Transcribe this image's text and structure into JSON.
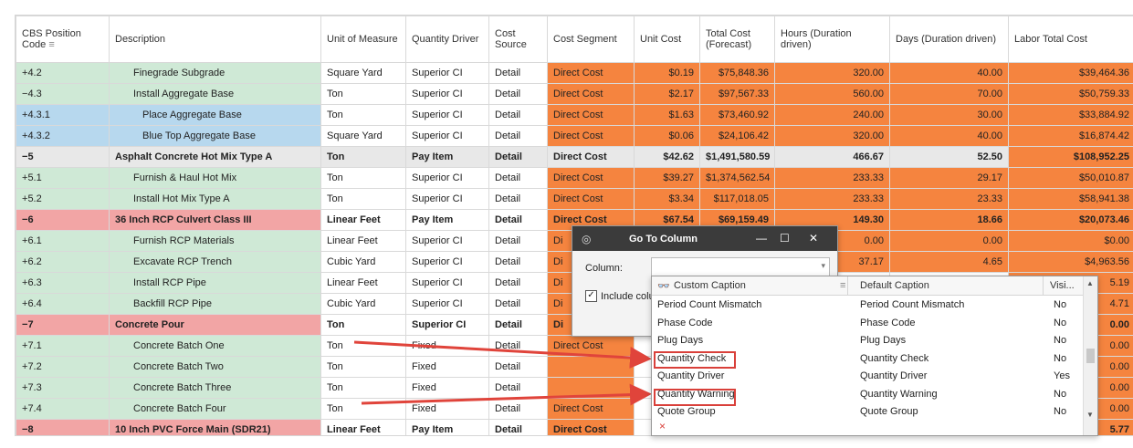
{
  "columns": {
    "code": "CBS Position Code",
    "description": "Description",
    "uom": "Unit of Measure",
    "qty_driver": "Quantity Driver",
    "cost_source": "Cost Source",
    "cost_segment": "Cost Segment",
    "unit_cost": "Unit Cost",
    "total_cost": "Total Cost (Forecast)",
    "hours": "Hours (Duration driven)",
    "days": "Days (Duration driven)",
    "labor_total": "Labor Total Cost"
  },
  "rows": [
    {
      "pm": "+",
      "code": "4.2",
      "description": "Finegrade Subgrade",
      "uom": "Square Yard",
      "qty_driver": "Superior CI",
      "cost_source": "Detail",
      "cost_segment": "Direct Cost",
      "unit_cost": "$0.19",
      "total_cost": "$75,848.36",
      "hours": "320.00",
      "days": "40.00",
      "labor_total": "$39,464.36"
    },
    {
      "pm": "−",
      "code": "4.3",
      "description": "Install Aggregate Base",
      "uom": "Ton",
      "qty_driver": "Superior CI",
      "cost_source": "Detail",
      "cost_segment": "Direct Cost",
      "unit_cost": "$2.17",
      "total_cost": "$97,567.33",
      "hours": "560.00",
      "days": "70.00",
      "labor_total": "$50,759.33"
    },
    {
      "pm": "+",
      "code": "4.3.1",
      "description": "Place Aggregate Base",
      "uom": "Ton",
      "qty_driver": "Superior CI",
      "cost_source": "Detail",
      "cost_segment": "Direct Cost",
      "unit_cost": "$1.63",
      "total_cost": "$73,460.92",
      "hours": "240.00",
      "days": "30.00",
      "labor_total": "$33,884.92"
    },
    {
      "pm": "+",
      "code": "4.3.2",
      "description": "Blue Top Aggregate Base",
      "uom": "Square Yard",
      "qty_driver": "Superior CI",
      "cost_source": "Detail",
      "cost_segment": "Direct Cost",
      "unit_cost": "$0.06",
      "total_cost": "$24,106.42",
      "hours": "320.00",
      "days": "40.00",
      "labor_total": "$16,874.42"
    },
    {
      "pm": "−",
      "code": "5",
      "description": "Asphalt Concrete Hot Mix Type A",
      "uom": "Ton",
      "qty_driver": "Pay Item",
      "cost_source": "Detail",
      "cost_segment": "Direct Cost",
      "unit_cost": "$42.62",
      "total_cost": "$1,491,580.59",
      "hours": "466.67",
      "days": "52.50",
      "labor_total": "$108,952.25"
    },
    {
      "pm": "+",
      "code": "5.1",
      "description": "Furnish & Haul Hot Mix",
      "uom": "Ton",
      "qty_driver": "Superior CI",
      "cost_source": "Detail",
      "cost_segment": "Direct Cost",
      "unit_cost": "$39.27",
      "total_cost": "$1,374,562.54",
      "hours": "233.33",
      "days": "29.17",
      "labor_total": "$50,010.87"
    },
    {
      "pm": "+",
      "code": "5.2",
      "description": "Install Hot Mix Type A",
      "uom": "Ton",
      "qty_driver": "Superior CI",
      "cost_source": "Detail",
      "cost_segment": "Direct Cost",
      "unit_cost": "$3.34",
      "total_cost": "$117,018.05",
      "hours": "233.33",
      "days": "23.33",
      "labor_total": "$58,941.38"
    },
    {
      "pm": "−",
      "code": "6",
      "description": "36 Inch RCP Culvert Class III",
      "uom": "Linear Feet",
      "qty_driver": "Pay Item",
      "cost_source": "Detail",
      "cost_segment": "Direct Cost",
      "unit_cost": "$67.54",
      "total_cost": "$69,159.49",
      "hours": "149.30",
      "days": "18.66",
      "labor_total": "$20,073.46"
    },
    {
      "pm": "+",
      "code": "6.1",
      "description": "Furnish RCP Materials",
      "uom": "Linear Feet",
      "qty_driver": "Superior CI",
      "cost_source": "Detail",
      "cost_segment": "Di",
      "unit_cost": "",
      "total_cost": "",
      "hours": "0.00",
      "days": "0.00",
      "labor_total": "$0.00"
    },
    {
      "pm": "+",
      "code": "6.2",
      "description": "Excavate RCP Trench",
      "uom": "Cubic Yard",
      "qty_driver": "Superior CI",
      "cost_source": "Detail",
      "cost_segment": "Di",
      "unit_cost": "",
      "total_cost": "",
      "hours": "37.17",
      "days": "4.65",
      "labor_total": "$4,963.56"
    },
    {
      "pm": "+",
      "code": "6.3",
      "description": "Install RCP Pipe",
      "uom": "Linear Feet",
      "qty_driver": "Superior CI",
      "cost_source": "Detail",
      "cost_segment": "Di",
      "unit_cost": "",
      "total_cost": "",
      "hours": "",
      "days": "",
      "labor_total": "5.19"
    },
    {
      "pm": "+",
      "code": "6.4",
      "description": "Backfill RCP Pipe",
      "uom": "Cubic Yard",
      "qty_driver": "Superior CI",
      "cost_source": "Detail",
      "cost_segment": "Di",
      "unit_cost": "",
      "total_cost": "",
      "hours": "",
      "days": "",
      "labor_total": "4.71"
    },
    {
      "pm": "−",
      "code": "7",
      "description": "Concrete Pour",
      "uom": "Ton",
      "qty_driver": "Superior CI",
      "cost_source": "Detail",
      "cost_segment": "Di",
      "unit_cost": "",
      "total_cost": "",
      "hours": "",
      "days": "",
      "labor_total": "0.00"
    },
    {
      "pm": "+",
      "code": "7.1",
      "description": "Concrete  Batch One",
      "uom": "Ton",
      "qty_driver": "Fixed",
      "cost_source": "Detail",
      "cost_segment": "Direct Cost",
      "unit_cost": "",
      "total_cost": "",
      "hours": "",
      "days": "",
      "labor_total": "0.00"
    },
    {
      "pm": "+",
      "code": "7.2",
      "description": "Concrete Batch Two",
      "uom": "Ton",
      "qty_driver": "Fixed",
      "cost_source": "Detail",
      "cost_segment": "",
      "unit_cost": "",
      "total_cost": "",
      "hours": "",
      "days": "",
      "labor_total": "0.00"
    },
    {
      "pm": "+",
      "code": "7.3",
      "description": "Concrete Batch Three",
      "uom": "Ton",
      "qty_driver": "Fixed",
      "cost_source": "Detail",
      "cost_segment": "",
      "unit_cost": "",
      "total_cost": "",
      "hours": "",
      "days": "",
      "labor_total": "0.00"
    },
    {
      "pm": "+",
      "code": "7.4",
      "description": "Concrete Batch Four",
      "uom": "Ton",
      "qty_driver": "Fixed",
      "cost_source": "Detail",
      "cost_segment": "Direct Cost",
      "unit_cost": "",
      "total_cost": "",
      "hours": "",
      "days": "",
      "labor_total": "0.00"
    },
    {
      "pm": "−",
      "code": "8",
      "description": "10 Inch PVC Force Main (SDR21)",
      "uom": "Linear Feet",
      "qty_driver": "Pay Item",
      "cost_source": "Detail",
      "cost_segment": "Direct Cost",
      "unit_cost": "",
      "total_cost": "",
      "hours": "",
      "days": "",
      "labor_total": "5.77"
    }
  ],
  "dialog": {
    "title": "Go To Column",
    "column_label": "Column:",
    "include_label": "Include colu"
  },
  "popup": {
    "headers": {
      "custom": "Custom Caption",
      "default": "Default Caption",
      "visible": "Visi..."
    },
    "items": [
      {
        "custom": "Period Count Mismatch",
        "default": "Period Count Mismatch",
        "visible": "No"
      },
      {
        "custom": "Phase Code",
        "default": "Phase Code",
        "visible": "No"
      },
      {
        "custom": "Plug Days",
        "default": "Plug Days",
        "visible": "No"
      },
      {
        "custom": "Quantity Check",
        "default": "Quantity Check",
        "visible": "No"
      },
      {
        "custom": "Quantity Driver",
        "default": "Quantity Driver",
        "visible": "Yes"
      },
      {
        "custom": "Quantity Warning",
        "default": "Quantity Warning",
        "visible": "No"
      },
      {
        "custom": "Quote Group",
        "default": "Quote Group",
        "visible": "No"
      }
    ],
    "close_glyph": "×"
  },
  "colors": {
    "orange": "#f5843f",
    "green": "#cfe9d6",
    "red": "#f2a5a5",
    "blue": "#b7d8ee",
    "grey": "#e8e8e8",
    "arrow": "#e0443b"
  }
}
